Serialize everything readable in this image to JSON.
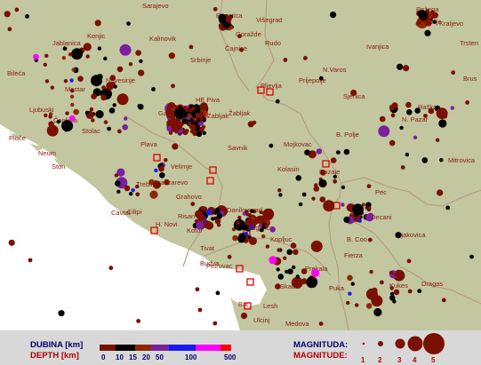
{
  "map": {
    "places": [
      "Sarajevo",
      "Rogatica",
      "Višegrad",
      "Požega",
      "Arilje",
      "Kraljevo",
      "Trsten",
      "Jablanica",
      "Konjic",
      "Goražde",
      "Čajnice",
      "Rudo",
      "Ivanjica",
      "Kalinovik",
      "Srbinje",
      "Bileća",
      "Mostar",
      "N.Varos",
      "Brus",
      "Nevesinje",
      "Prijepolje",
      "Ljubuski",
      "HE Piva",
      "Pljevlja",
      "Sjenica",
      "Raška",
      "Čapljina",
      "Gacko",
      "Žabljak",
      "N. Pazar",
      "Stolac",
      "B. Polje",
      "Ploče",
      "Mojkovac",
      "Neum",
      "Plava",
      "Ston",
      "Savnik",
      "Kolasin",
      "Rozaje",
      "Mitrovica",
      "Velimje",
      "Trebinje",
      "Grancarevo",
      "Grahovo",
      "Danilovgrad",
      "Pec",
      "Cavtat",
      "Cilipi",
      "Decani",
      "Risan",
      "H. Novi",
      "Podgorica",
      "Kotor",
      "B. Coo",
      "Djakovica",
      "Tivat",
      "Kopljuc",
      "Fierza",
      "Budva",
      "Prekala",
      "Petrovac",
      "Dragas",
      "Skadar",
      "Puka",
      "Kukes",
      "Bar",
      "Ulcinj",
      "Medova",
      "Zabljak",
      "Lesh"
    ]
  },
  "legend": {
    "depth_label_local": "DUBINA [km]",
    "depth_label": "DEPTH [km]",
    "depth_ticks": [
      "0",
      "10",
      "15",
      "20",
      "50",
      "100",
      "500"
    ],
    "depth_colors": [
      "#7a1000",
      "#000000",
      "#8b2a00",
      "#7a1fa0",
      "#1a1aee",
      "#ff00ff",
      "#ff0000"
    ],
    "magnitude_label_local": "MAGNITUDA:",
    "magnitude_label": "MAGNITUDE:",
    "magnitudes": [
      "1",
      "2",
      "3",
      "4",
      "5"
    ]
  }
}
